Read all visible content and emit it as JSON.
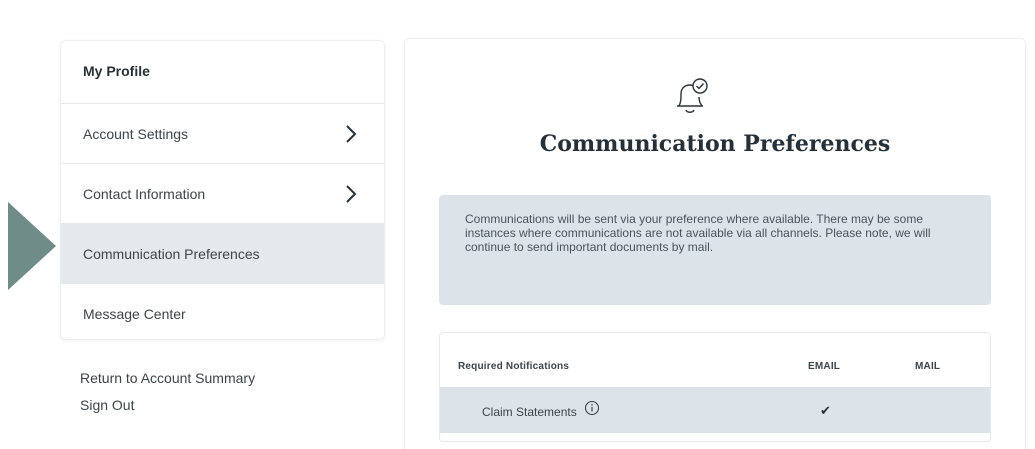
{
  "sidebar": {
    "items": [
      {
        "label": "My Profile"
      },
      {
        "label": "Account Settings"
      },
      {
        "label": "Contact Information"
      },
      {
        "label": "Communication Preferences"
      },
      {
        "label": "Message Center"
      }
    ],
    "links": [
      {
        "label": "Return to Account Summary"
      },
      {
        "label": "Sign Out"
      }
    ]
  },
  "main": {
    "title": "Communication Preferences",
    "icon": "bell-check-icon",
    "info_text": "Communications will be sent via your preference where available. There may be some instances where communications are not available via all channels. Please note, we will continue to send important documents by mail.",
    "table": {
      "headers": [
        "Required Notifications",
        "EMAIL",
        "MAIL"
      ],
      "rows": [
        {
          "label": "Claim Statements",
          "email": "✔",
          "mail": ""
        }
      ]
    }
  },
  "colors": {
    "accent_arrow": "#6f8c86",
    "active_bg": "#e4e9ec",
    "info_bg": "#dde4e9"
  }
}
